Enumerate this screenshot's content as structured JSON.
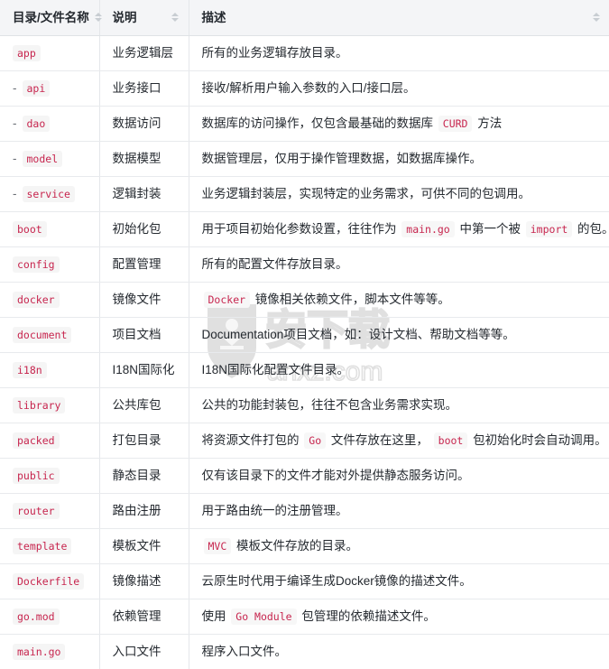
{
  "table": {
    "columns": [
      {
        "label": "目录/文件名称",
        "sort_icon": "sort-arrows-icon",
        "sortable": true
      },
      {
        "label": "说明",
        "sort_icon": "sort-arrows-icon",
        "sortable": true
      },
      {
        "label": "描述",
        "sort_icon": "sort-arrows-icon",
        "sortable": true
      }
    ],
    "rows": [
      {
        "name": "app",
        "indent": false,
        "desc": "业务逻辑层",
        "detail_parts": [
          {
            "type": "text",
            "value": "所有的业务逻辑存放目录。"
          }
        ]
      },
      {
        "name": "api",
        "indent": true,
        "indent_marker": "-",
        "desc": "业务接口",
        "detail_parts": [
          {
            "type": "text",
            "value": "接收/解析用户输入参数的入口/接口层。"
          }
        ]
      },
      {
        "name": "dao",
        "indent": true,
        "indent_marker": "-",
        "desc": "数据访问",
        "detail_parts": [
          {
            "type": "text",
            "value": "数据库的访问操作，仅包含最基础的数据库 "
          },
          {
            "type": "code",
            "value": "CURD"
          },
          {
            "type": "text",
            "value": " 方法"
          }
        ]
      },
      {
        "name": "model",
        "indent": true,
        "indent_marker": "-",
        "desc": "数据模型",
        "detail_parts": [
          {
            "type": "text",
            "value": "数据管理层，仅用于操作管理数据，如数据库操作。"
          }
        ]
      },
      {
        "name": "service",
        "indent": true,
        "indent_marker": "-",
        "desc": "逻辑封装",
        "detail_parts": [
          {
            "type": "text",
            "value": "业务逻辑封装层，实现特定的业务需求，可供不同的包调用。"
          }
        ]
      },
      {
        "name": "boot",
        "indent": false,
        "desc": "初始化包",
        "detail_parts": [
          {
            "type": "text",
            "value": "用于项目初始化参数设置，往往作为 "
          },
          {
            "type": "code",
            "value": "main.go"
          },
          {
            "type": "text",
            "value": " 中第一个被 "
          },
          {
            "type": "code",
            "value": "import"
          },
          {
            "type": "text",
            "value": " 的包。"
          }
        ]
      },
      {
        "name": "config",
        "indent": false,
        "desc": "配置管理",
        "detail_parts": [
          {
            "type": "text",
            "value": "所有的配置文件存放目录。"
          }
        ]
      },
      {
        "name": "docker",
        "indent": false,
        "desc": "镜像文件",
        "detail_parts": [
          {
            "type": "code",
            "value": "Docker"
          },
          {
            "type": "text",
            "value": " 镜像相关依赖文件，脚本文件等等。"
          }
        ]
      },
      {
        "name": "document",
        "indent": false,
        "desc": "项目文档",
        "detail_parts": [
          {
            "type": "text",
            "value": "Documentation项目文档，如：设计文档、帮助文档等等。"
          }
        ]
      },
      {
        "name": "i18n",
        "indent": false,
        "desc": "I18N国际化",
        "detail_parts": [
          {
            "type": "text",
            "value": "I18N国际化配置文件目录。"
          }
        ]
      },
      {
        "name": "library",
        "indent": false,
        "desc": "公共库包",
        "detail_parts": [
          {
            "type": "text",
            "value": "公共的功能封装包，往往不包含业务需求实现。"
          }
        ]
      },
      {
        "name": "packed",
        "indent": false,
        "desc": "打包目录",
        "detail_parts": [
          {
            "type": "text",
            "value": "将资源文件打包的 "
          },
          {
            "type": "code",
            "value": "Go"
          },
          {
            "type": "text",
            "value": " 文件存放在这里， "
          },
          {
            "type": "code",
            "value": "boot"
          },
          {
            "type": "text",
            "value": " 包初始化时会自动调用。"
          }
        ]
      },
      {
        "name": "public",
        "indent": false,
        "desc": "静态目录",
        "detail_parts": [
          {
            "type": "text",
            "value": "仅有该目录下的文件才能对外提供静态服务访问。"
          }
        ]
      },
      {
        "name": "router",
        "indent": false,
        "desc": "路由注册",
        "detail_parts": [
          {
            "type": "text",
            "value": "用于路由统一的注册管理。"
          }
        ]
      },
      {
        "name": "template",
        "indent": false,
        "desc": "模板文件",
        "detail_parts": [
          {
            "type": "code",
            "value": "MVC"
          },
          {
            "type": "text",
            "value": " 模板文件存放的目录。"
          }
        ]
      },
      {
        "name": "Dockerfile",
        "indent": false,
        "desc": "镜像描述",
        "detail_parts": [
          {
            "type": "text",
            "value": "云原生时代用于编译生成Docker镜像的描述文件。"
          }
        ]
      },
      {
        "name": "go.mod",
        "indent": false,
        "desc": "依赖管理",
        "detail_parts": [
          {
            "type": "text",
            "value": "使用 "
          },
          {
            "type": "code",
            "value": "Go Module"
          },
          {
            "type": "text",
            "value": " 包管理的依赖描述文件。"
          }
        ]
      },
      {
        "name": "main.go",
        "indent": false,
        "desc": "入口文件",
        "detail_parts": [
          {
            "type": "text",
            "value": "程序入口文件。"
          }
        ]
      }
    ]
  },
  "watermark": {
    "icon": "shield-logo-icon",
    "text_cn": "安下载",
    "text_domain": "anxz.com"
  },
  "colors": {
    "header_bg": "#f4f5f7",
    "border": "#e4e7ea",
    "row_border": "#e8eaed",
    "code_text": "#c7254e",
    "code_bg": "#f5f5f5",
    "text": "#24292f",
    "sort_icon": "#c6cbd1"
  }
}
